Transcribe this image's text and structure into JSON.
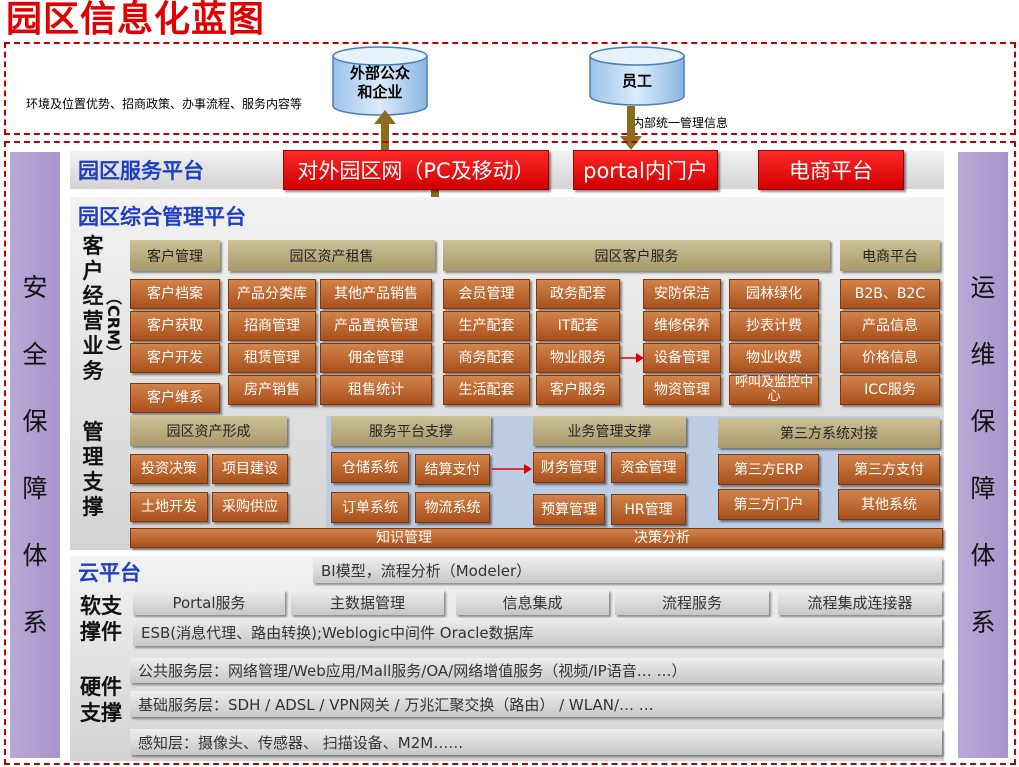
{
  "title": "园区信息化蓝图",
  "top": {
    "left_note": "环境及位置优势、招商政策、办事流程、服务内容等",
    "cylinder_external": "外部公众\n和企业",
    "cylinder_staff": "员工",
    "staff_note": "内部统一管理信息"
  },
  "sidebars": {
    "left": "安全保障体系",
    "right": "运维保障体系"
  },
  "service_platform": {
    "title": "园区服务平台",
    "buttons": [
      "对外园区网（PC及移动）",
      "portal内门户",
      "电商平台"
    ]
  },
  "management_platform": {
    "title": "园区综合管理平台",
    "crm_label_main": "客户经营业务",
    "crm_label_sub": "（CRM）",
    "support_label": "管理支撑",
    "headers": {
      "customer_mgmt": "客户管理",
      "asset_lease": "园区资产租售",
      "customer_service": "园区客户服务",
      "ecommerce": "电商平台",
      "asset_formation": "园区资产形成",
      "service_support": "服务平台支撑",
      "business_support": "业务管理支撑",
      "third_party": "第三方系统对接"
    },
    "customer_items": [
      "客户档案",
      "客户获取",
      "客户开发",
      "客户维系"
    ],
    "lease_col1": [
      "产品分类库",
      "招商管理",
      "租赁管理",
      "房产销售"
    ],
    "lease_col2": [
      "其他产品销售",
      "产品置换管理",
      "佣金管理",
      "租售统计"
    ],
    "service_col1": [
      "会员管理",
      "生产配套",
      "商务配套",
      "生活配套"
    ],
    "service_col2": [
      "政务配套",
      "IT配套",
      "物业服务",
      "客户服务"
    ],
    "service_col3": [
      "安防保洁",
      "维修保养",
      "设备管理",
      "物资管理"
    ],
    "service_col4": [
      "园林绿化",
      "抄表计费",
      "物业收费",
      "呼叫及监控中心"
    ],
    "ecommerce_items": [
      "B2B、B2C",
      "产品信息",
      "价格信息",
      "ICC服务"
    ],
    "asset_formation_items": [
      "投资决策",
      "项目建设",
      "土地开发",
      "采购供应"
    ],
    "service_support_items": [
      "仓储系统",
      "结算支付",
      "订单系统",
      "物流系统"
    ],
    "business_support_items": [
      "财务管理",
      "资金管理",
      "预算管理",
      "HR管理"
    ],
    "third_party_items": [
      "第三方ERP",
      "第三方支付",
      "第三方门户",
      "其他系统"
    ],
    "bottom_bar": [
      "知识管理",
      "决策分析"
    ]
  },
  "cloud_platform": {
    "title": "云平台",
    "bi": "BI模型，流程分析（Modeler）",
    "software_label": "软支撑件",
    "software_items": [
      "Portal服务",
      "主数据管理",
      "信息集成",
      "流程服务",
      "流程集成连接器"
    ],
    "esb": "ESB(消息代理、路由转换);Weblogic中间件    Oracle数据库",
    "hardware_label": "硬件支撑",
    "layers": [
      "公共服务层：网络管理/Web应用/Mall服务/OA/网络增值服务（视频/IP语音…  …）",
      "基础服务层：SDH  / ADSL  / VPN网关  / 万兆汇聚交换（路由） / WLAN/…  …",
      "感知层：摄像头、传感器、 扫描设备、M2M……"
    ]
  },
  "colors": {
    "title_red": "#e00000",
    "section_blue": "#1f3fbf",
    "button_red": "#e60000",
    "olive": "#b8aa7e",
    "orange": "#b9642e",
    "sidebar_purple": "#b09fd0",
    "support_blue": "#bccde3"
  }
}
